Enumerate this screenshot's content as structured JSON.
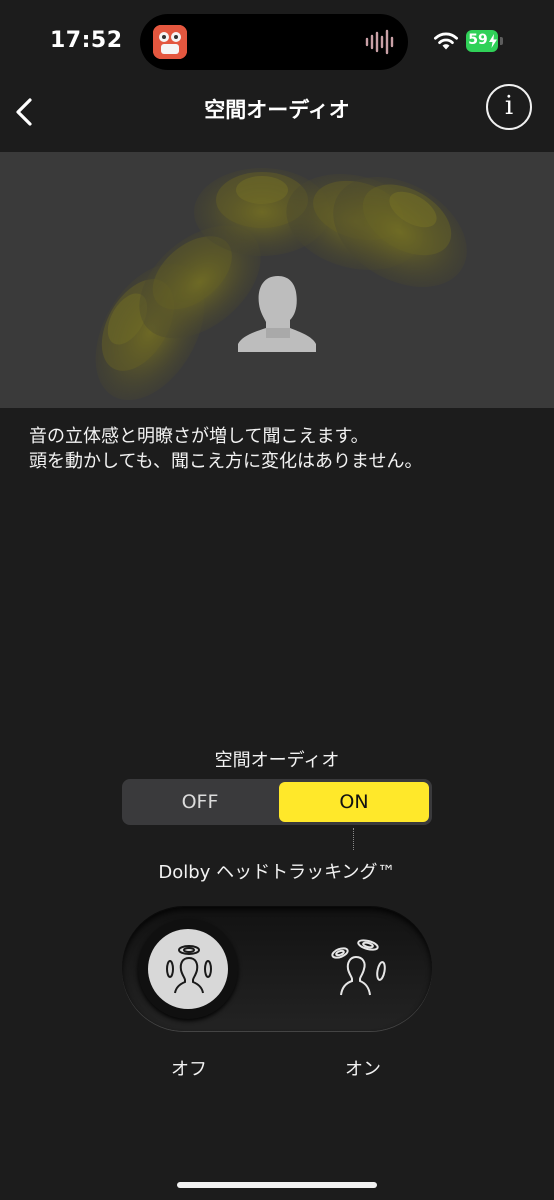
{
  "status_bar": {
    "time": "17:52",
    "battery": "59"
  },
  "nav": {
    "title": "空間オーディオ",
    "info_label": "i"
  },
  "description": {
    "line1": "音の立体感と明瞭さが増して聞こえます。",
    "line2": "頭を動かしても、聞こえ方に変化はありません。"
  },
  "spatial_audio": {
    "label": "空間オーディオ",
    "off_label": "OFF",
    "on_label": "ON",
    "selected": "ON"
  },
  "head_tracking": {
    "label": "Dolby ヘッドトラッキング™",
    "off_label": "オフ",
    "on_label": "オン",
    "selected": "オフ"
  },
  "colors": {
    "accent": "#ffe82a",
    "background": "#1c1c1c",
    "illustration_bg": "#3a3a3a"
  },
  "icons": [
    "chevron-left-icon",
    "info-icon",
    "wifi-icon",
    "battery-icon",
    "head-tracking-off-icon",
    "head-tracking-on-icon",
    "listener-silhouette"
  ]
}
